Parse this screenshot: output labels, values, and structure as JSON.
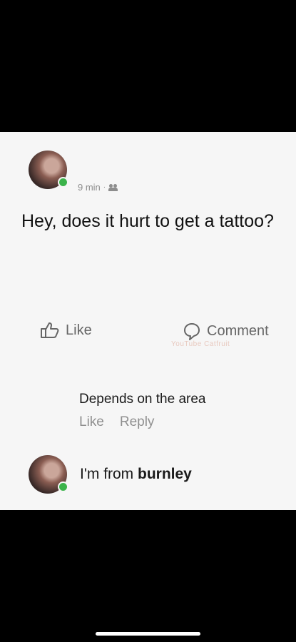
{
  "post": {
    "time": "9 min",
    "separator": "·",
    "text": "Hey, does it hurt to get a tattoo?",
    "like_label": "Like",
    "comment_label": "Comment",
    "watermark": "YouTube Catfruit"
  },
  "comment": {
    "text": "Depends on the area",
    "like_label": "Like",
    "reply_label": "Reply"
  },
  "reply": {
    "prefix": "I'm from ",
    "bold": "burnley"
  },
  "colors": {
    "online": "#3bb34a",
    "card": "#f6f6f6",
    "muted": "#8d8d8d"
  },
  "icons": [
    "thumbs-up-icon",
    "comment-icon",
    "audience-icon"
  ]
}
